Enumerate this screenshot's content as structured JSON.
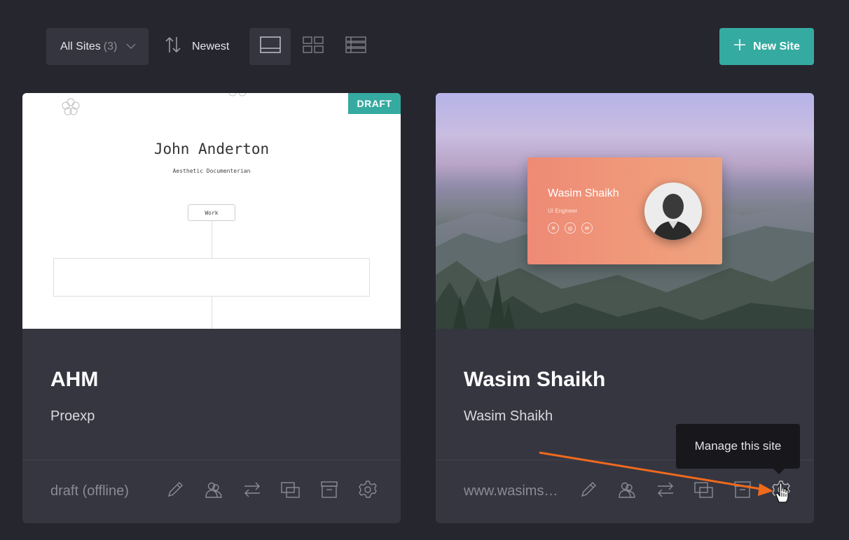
{
  "toolbar": {
    "filter_label": "All Sites",
    "filter_count": "(3)",
    "sort_label": "Newest",
    "new_site_label": "New Site",
    "accent_color": "#35aaa0",
    "view_modes": [
      "single-column",
      "grid",
      "list"
    ],
    "active_view": "single-column"
  },
  "cards": [
    {
      "title": "AHM",
      "subtitle": "Proexp",
      "status": "draft (offline)",
      "badge": "DRAFT",
      "preview": {
        "name": "John Anderton",
        "role": "Aesthetic Documenterian",
        "button": "Work"
      }
    },
    {
      "title": "Wasim Shaikh",
      "subtitle": "Wasim Shaikh",
      "status": "www.wasims…",
      "preview": {
        "name": "Wasim Shaikh",
        "role": "UI Engineer"
      }
    }
  ],
  "card_actions": [
    "pencil-icon",
    "users-icon",
    "transfer-icon",
    "duplicate-icon",
    "archive-icon",
    "gear-icon"
  ],
  "tooltip": {
    "text": "Manage this site"
  }
}
